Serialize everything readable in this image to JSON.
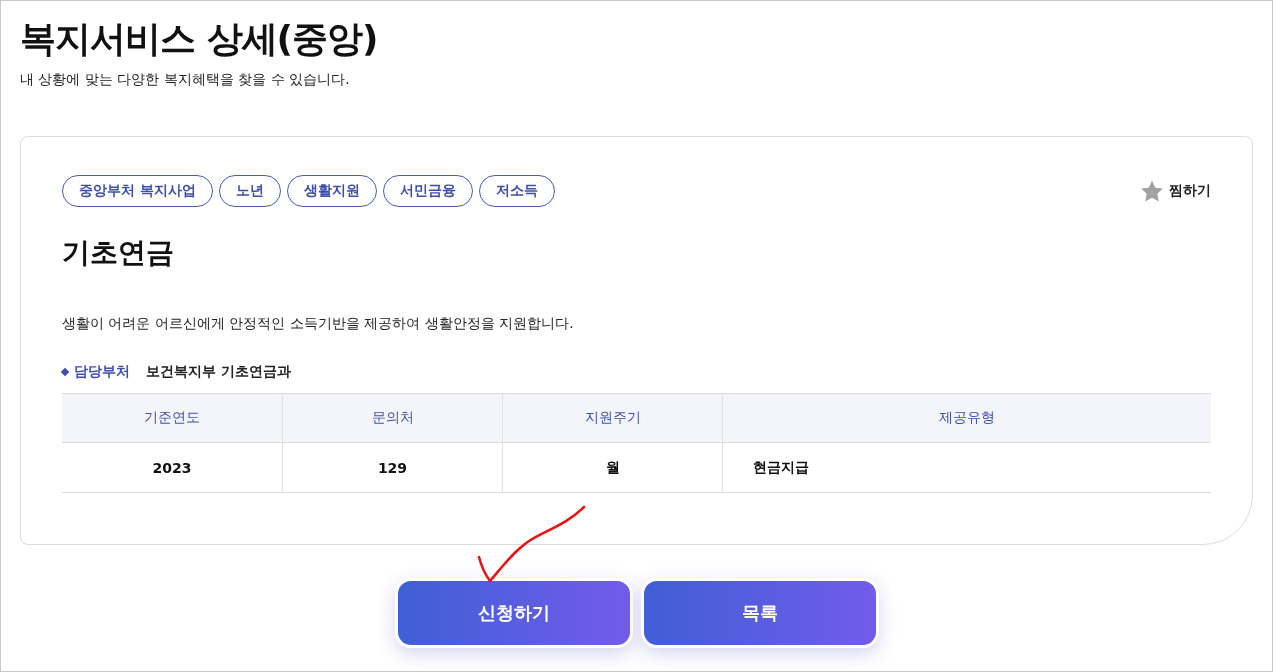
{
  "page": {
    "title": "복지서비스 상세(중앙)",
    "subtitle": "내 상황에 맞는 다양한 복지혜택을 찾을 수 있습니다."
  },
  "service": {
    "tags": [
      "중앙부처 복지사업",
      "노년",
      "생활지원",
      "서민금융",
      "저소득"
    ],
    "favorite": {
      "label": "찜하기",
      "selected": false
    },
    "name": "기초연금",
    "description": "생활이 어려운 어르신에게 안정적인 소득기반을 제공하여 생활안정을 지원합니다.",
    "department": {
      "label": "담당부처",
      "value": "보건복지부 기초연금과"
    },
    "table": {
      "columns": [
        "기준연도",
        "문의처",
        "지원주기",
        "제공유형"
      ],
      "rows": [
        [
          "2023",
          "129",
          "월",
          "현금지급"
        ]
      ]
    }
  },
  "buttons": [
    "신청하기",
    "목록"
  ]
}
